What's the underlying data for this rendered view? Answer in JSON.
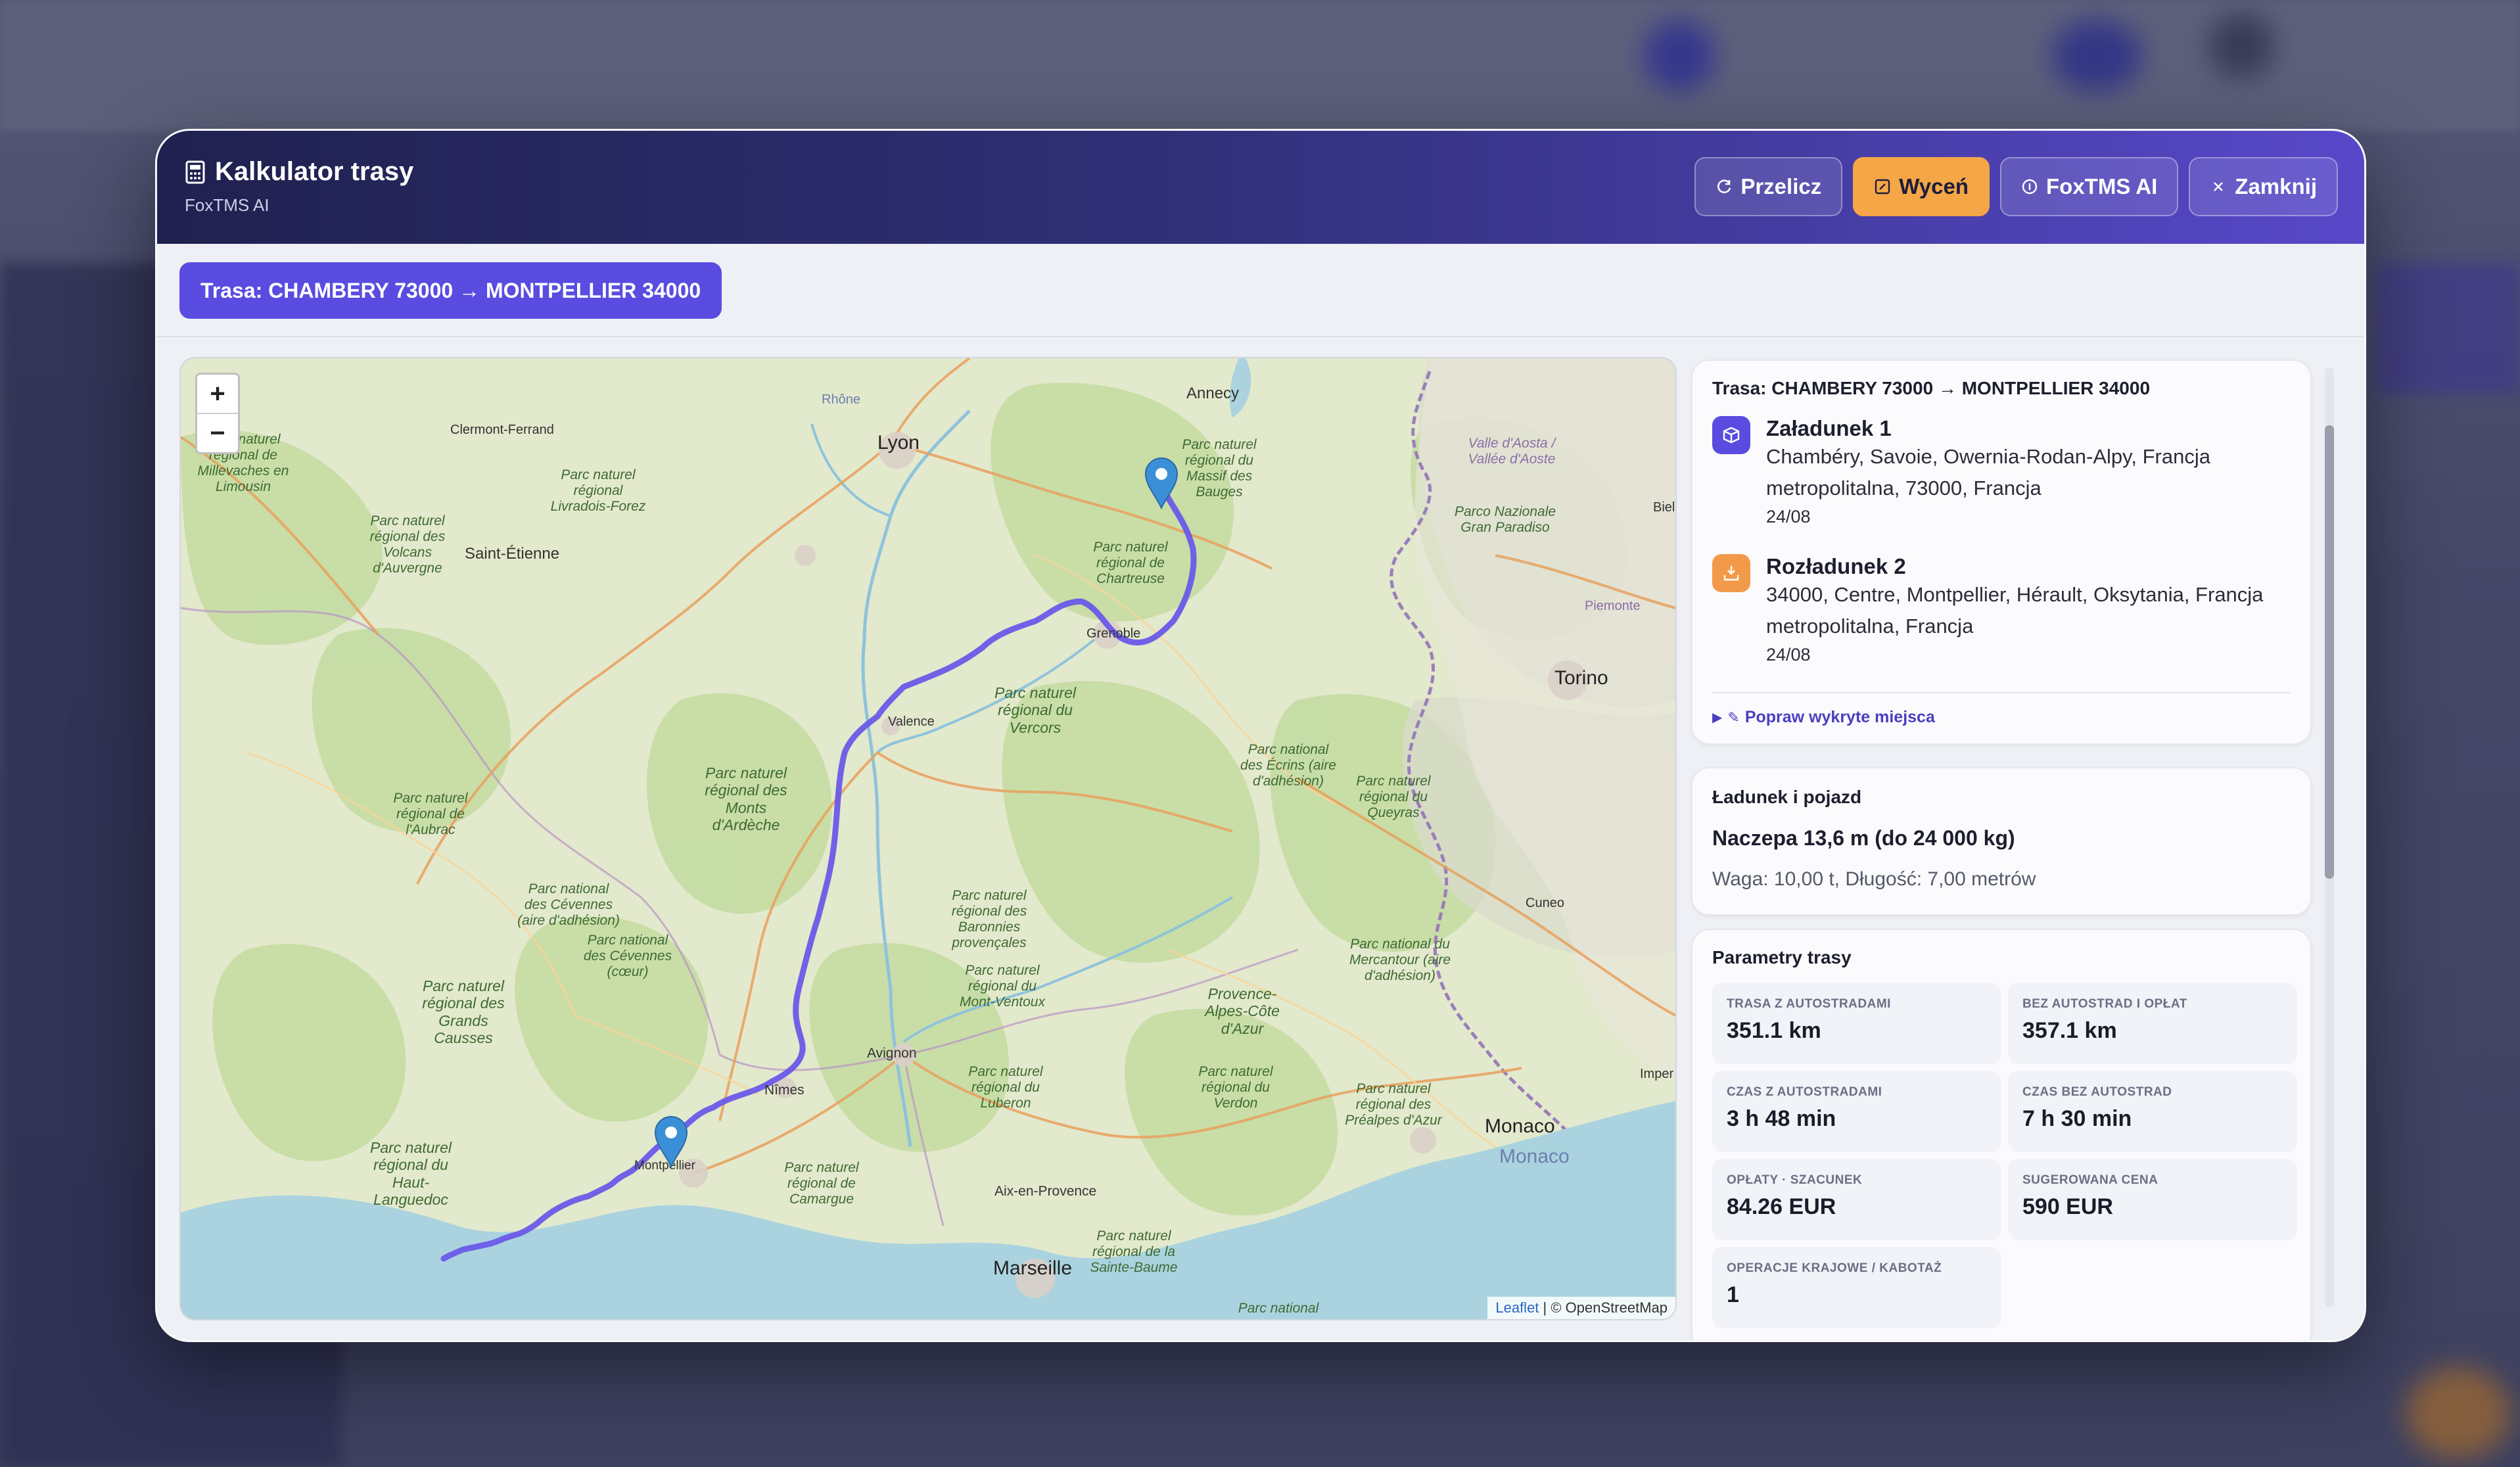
{
  "modal": {
    "title": "Kalkulator trasy",
    "subtitle": "FoxTMS AI",
    "buttons": {
      "recalc": "Przelicz",
      "price": "Wyceń",
      "ai": "FoxTMS AI",
      "close": "Zamknij"
    },
    "route_pill": "Trasa: CHAMBERY 73000 → MONTPELLIER 34000"
  },
  "colors": {
    "accent": "#5a4ce0",
    "orange": "#f5a646",
    "route_line": "#6a5ae8"
  },
  "map": {
    "zoom_in": "+",
    "zoom_out": "−",
    "attribution_leaflet": "Leaflet",
    "attribution_rest": " | © OpenStreetMap",
    "cities": {
      "lyon": "Lyon",
      "annecy": "Annecy",
      "saint_etienne": "Saint-Étienne",
      "clermont": "Clermont-Ferrand",
      "grenoble": "Grenoble",
      "valence": "Valence",
      "torino": "Torino",
      "cuneo": "Cuneo",
      "avignon": "Avignon",
      "nimes": "Nîmes",
      "montpellier": "Montpellier",
      "marseille": "Marseille",
      "aix": "Aix-en-Provence",
      "monaco": "Monaco",
      "monaco2": "Monaco",
      "biella": "Biel",
      "imperia": "Imper",
      "piemonte": "Piemonte",
      "rhone": "Rhône",
      "valle": "Valle d'Aosta / Vallée d'Aoste"
    },
    "parks": {
      "p1": "Parc naturel régional de Millevaches en Limousin",
      "p2": "Parc naturel régional Livradois-Forez",
      "p3": "Parc naturel régional des Volcans d'Auvergne",
      "p4": "Parc naturel régional du Massif des Bauges",
      "p5": "Parc naturel régional de Chartreuse",
      "p6": "Parc naturel régional du Vercors",
      "p7": "Parc naturel régional des Monts d'Ardèche",
      "p8": "Parc naturel régional de l'Aubrac",
      "p9": "Parc national des Écrins (aire d'adhésion)",
      "p10": "Parc naturel régional du Queyras",
      "p11": "Parc national des Cévennes (aire d'adhésion)",
      "p12": "Parc national des Cévennes (cœur)",
      "p13": "Parc naturel régional des Baronnies provençales",
      "p14": "Parc naturel régional du Mont-Ventoux",
      "p15": "Parc naturel régional des Grands Causses",
      "p16": "Parc naturel régional du Haut-Languedoc",
      "p17": "Parc naturel régional du Luberon",
      "p18": "Parc naturel régional du Verdon",
      "p19": "Parc naturel régional des Préalpes d'Azur",
      "p20": "Parc national du Mercantour (aire d'adhésion)",
      "p21": "Provence-Alpes-Côte d'Azur",
      "p22": "Parc naturel régional de Camargue",
      "p23": "Parc naturel régional de la Sainte-Baume",
      "p24": "Parco Nazionale Gran Paradiso",
      "p25": "Parc national"
    }
  },
  "route_card": {
    "title": "Trasa: CHAMBERY 73000 → MONTPELLIER 34000",
    "stops": [
      {
        "title": "Załadunek 1",
        "address": "Chambéry, Savoie, Owernia-Rodan-Alpy, Francja metropolitalna, 73000, Francja",
        "date": "24/08",
        "icon": "box-icon"
      },
      {
        "title": "Rozładunek 2",
        "address": "34000, Centre, Montpellier, Hérault, Oksytania, Francja metropolitalna, Francja",
        "date": "24/08",
        "icon": "unload-icon"
      }
    ],
    "fix_link": "Popraw wykryte miejsca"
  },
  "cargo_card": {
    "title": "Ładunek i pojazd",
    "vehicle": "Naczepa 13,6 m (do 24 000 kg)",
    "details": "Waga: 10,00 t, Długość: 7,00 metrów"
  },
  "params_card": {
    "title": "Parametry trasy",
    "items": [
      {
        "label": "TRASA Z AUTOSTRADAMI",
        "value": "351.1 km"
      },
      {
        "label": "BEZ AUTOSTRAD I OPŁAT",
        "value": "357.1 km"
      },
      {
        "label": "CZAS Z AUTOSTRADAMI",
        "value": "3 h 48 min"
      },
      {
        "label": "CZAS BEZ AUTOSTRAD",
        "value": "7 h 30 min"
      },
      {
        "label": "OPŁATY · SZACUNEK",
        "value": "84.26 EUR"
      },
      {
        "label": "SUGEROWANA CENA",
        "value": "590 EUR"
      },
      {
        "label": "OPERACJE KRAJOWE / KABOTAŻ",
        "value": "1"
      }
    ]
  }
}
